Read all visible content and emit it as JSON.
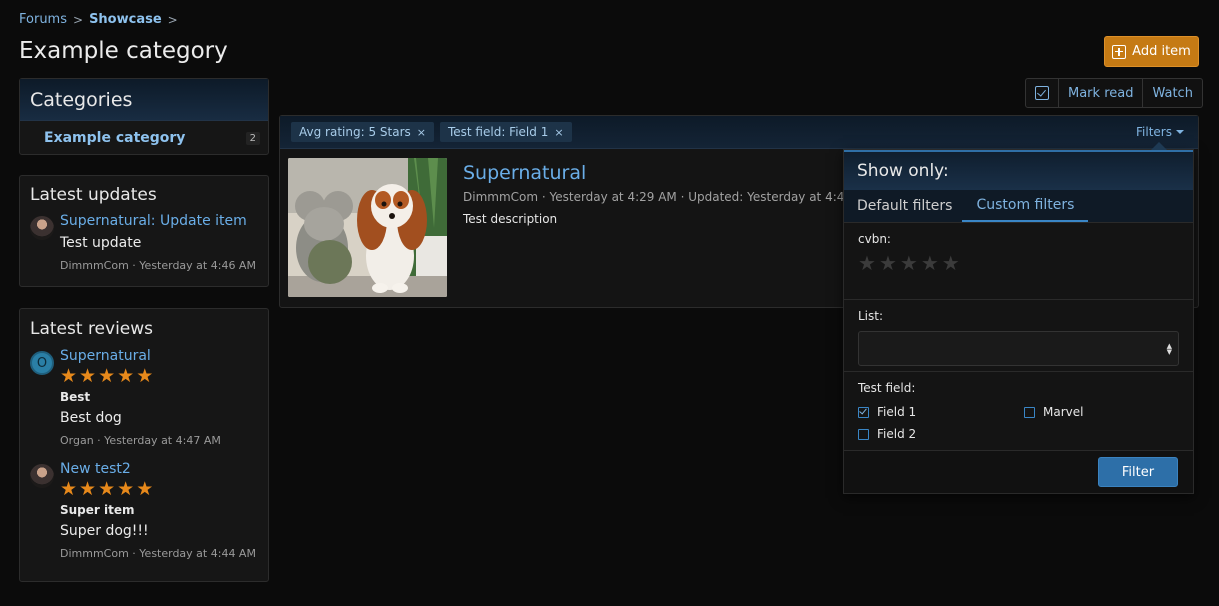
{
  "breadcrumb": {
    "forums": "Forums",
    "showcase": "Showcase",
    "sep1": ">",
    "sep2": ">"
  },
  "page_title": "Example category",
  "add_item_label": "Add item",
  "actions": {
    "mark_read": "Mark read",
    "watch": "Watch"
  },
  "categories": {
    "title": "Categories",
    "items": [
      {
        "name": "Example category",
        "count": "2"
      }
    ]
  },
  "latest_updates": {
    "title": "Latest updates",
    "items": [
      {
        "title": "Supernatural: Update item",
        "text": "Test update",
        "meta": "DimmmCom · Yesterday at 4:46 AM"
      }
    ]
  },
  "latest_reviews": {
    "title": "Latest reviews",
    "items": [
      {
        "avatar_letter": "O",
        "title": "Supernatural",
        "rating": 5,
        "label": "Best",
        "text": "Best dog",
        "meta": "Organ · Yesterday at 4:47 AM"
      },
      {
        "title": "New test2",
        "rating": 5,
        "label": "Super item",
        "text": "Super dog!!!",
        "meta": "DimmmCom · Yesterday at 4:44 AM"
      }
    ]
  },
  "filter_chips": [
    {
      "label": "Avg rating: 5 Stars",
      "remove": "×"
    },
    {
      "label": "Test field: Field 1",
      "remove": "×"
    }
  ],
  "filters_toggle": "Filters",
  "item": {
    "title": "Supernatural",
    "meta": "DimmmCom · Yesterday at 4:29 AM · Updated: Yesterday at 4:46 AM ·",
    "description": "Test description"
  },
  "filter_popup": {
    "title": "Show only:",
    "tabs": [
      "Default filters",
      "Custom filters"
    ],
    "active_tab": 1,
    "cvbn_label": "cvbn:",
    "list_label": "List:",
    "list_value": "",
    "test_field_label": "Test field:",
    "options": [
      {
        "label": "Field 1",
        "checked": true
      },
      {
        "label": "Marvel",
        "checked": false
      },
      {
        "label": "Field 2",
        "checked": false
      }
    ],
    "submit": "Filter"
  },
  "colors": {
    "accent": "#6aaee8",
    "add_button": "#c57a14",
    "star": "#e7891b",
    "filter_button": "#2d6fa8"
  },
  "icons": {
    "add": "plus-square-icon",
    "mark": "checkbox-icon",
    "star": "star-icon"
  }
}
